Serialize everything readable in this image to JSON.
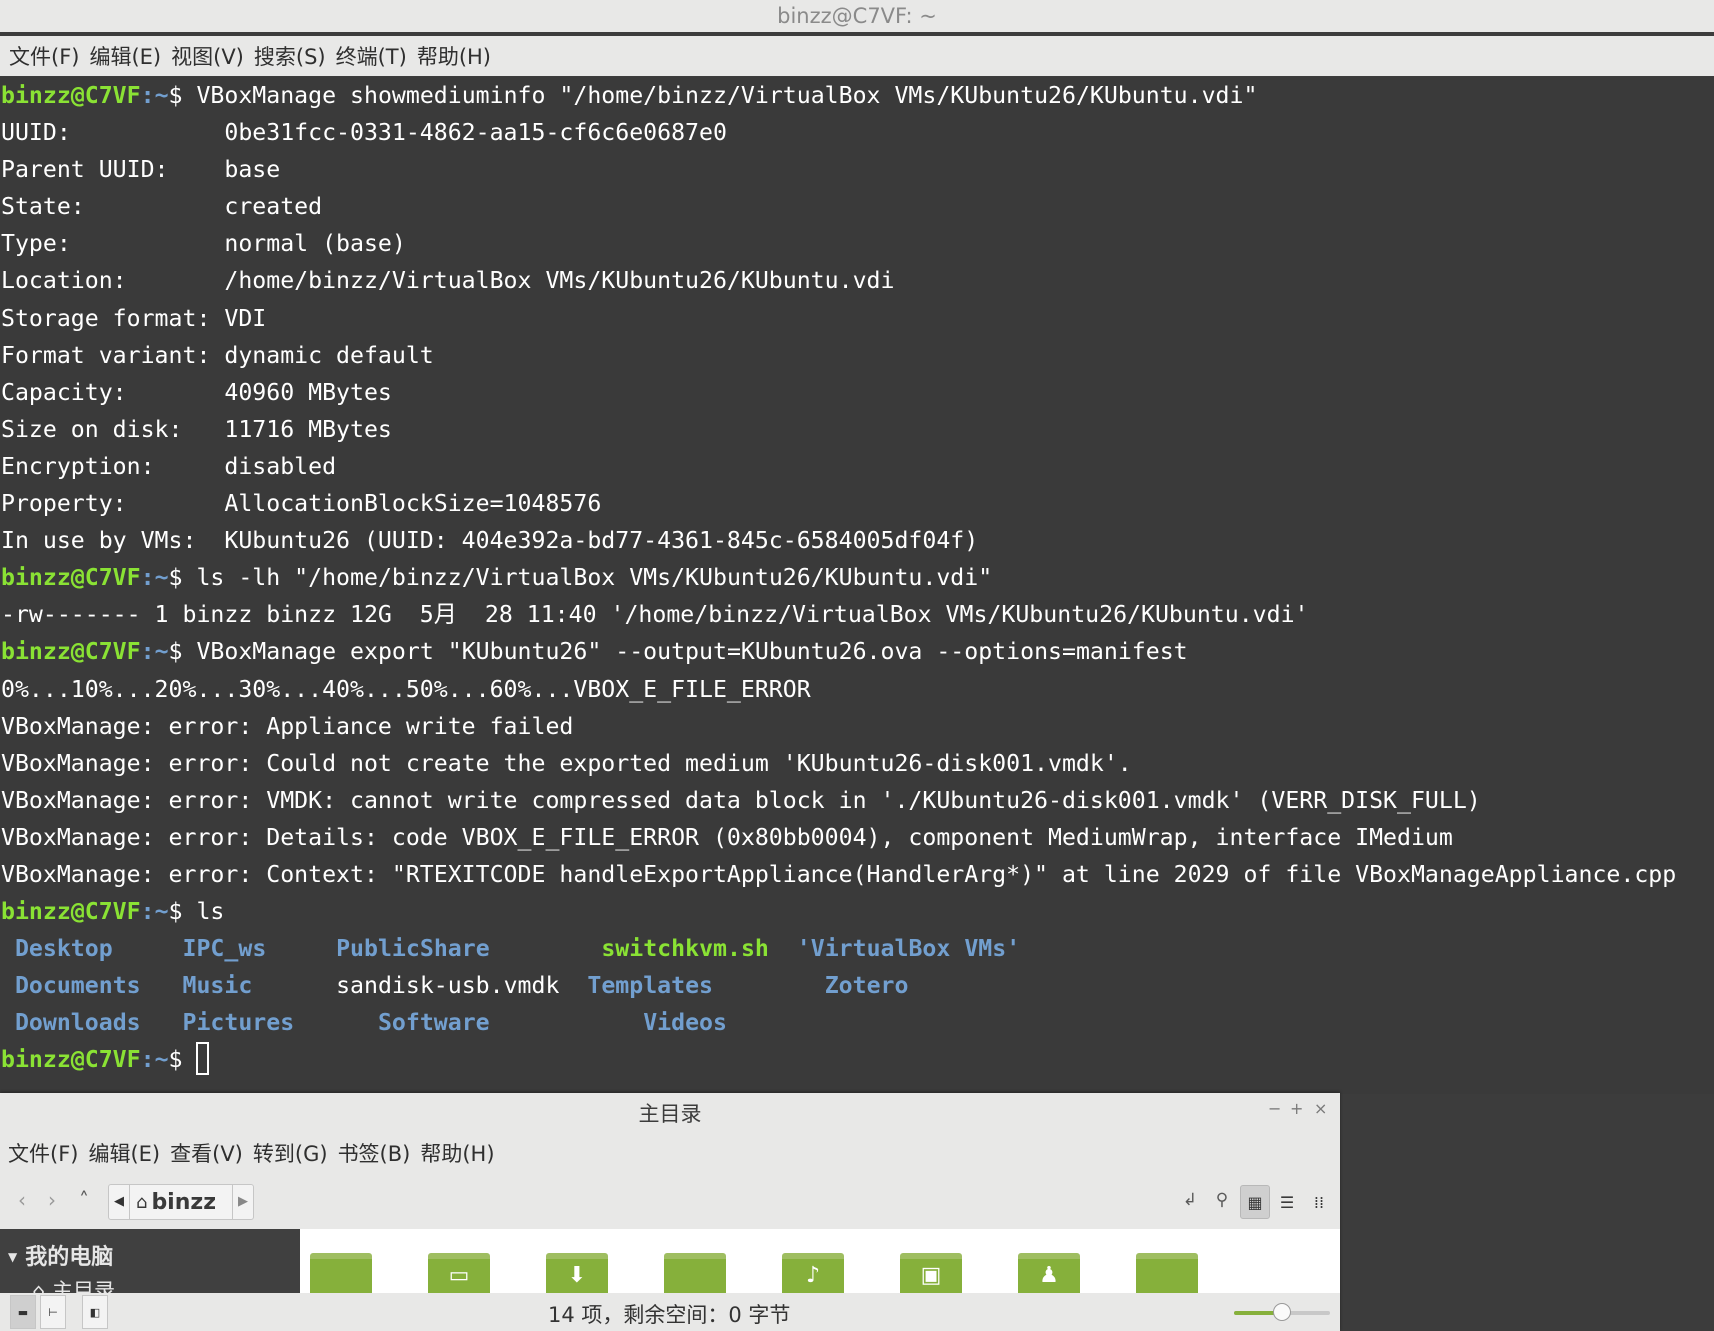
{
  "terminal": {
    "title": "binzz@C7VF: ~",
    "menu": [
      "文件(F)",
      "编辑(E)",
      "视图(V)",
      "搜索(S)",
      "终端(T)",
      "帮助(H)"
    ],
    "prompt_user": "binzz@C7VF",
    "prompt_path": ":~",
    "prompt_symbol": "$",
    "cmd1": " VBoxManage showmediuminfo \"/home/binzz/VirtualBox VMs/KUbuntu26/KUbuntu.vdi\"",
    "info": [
      "UUID:           0be31fcc-0331-4862-aa15-cf6c6e0687e0",
      "Parent UUID:    base",
      "State:          created",
      "Type:           normal (base)",
      "Location:       /home/binzz/VirtualBox VMs/KUbuntu26/KUbuntu.vdi",
      "Storage format: VDI",
      "Format variant: dynamic default",
      "Capacity:       40960 MBytes",
      "Size on disk:   11716 MBytes",
      "Encryption:     disabled",
      "Property:       AllocationBlockSize=1048576",
      "In use by VMs:  KUbuntu26 (UUID: 404e392a-bd77-4361-845c-6584005df04f)"
    ],
    "cmd2": " ls -lh \"/home/binzz/VirtualBox VMs/KUbuntu26/KUbuntu.vdi\"",
    "ls_out": "-rw------- 1 binzz binzz 12G  5月  28 11:40 '/home/binzz/VirtualBox VMs/KUbuntu26/KUbuntu.vdi'",
    "cmd3": " VBoxManage export \"KUbuntu26\" --output=KUbuntu26.ova --options=manifest",
    "export_out": [
      "0%...10%...20%...30%...40%...50%...60%...VBOX_E_FILE_ERROR",
      "VBoxManage: error: Appliance write failed",
      "VBoxManage: error: Could not create the exported medium 'KUbuntu26-disk001.vmdk'.",
      "VBoxManage: error: VMDK: cannot write compressed data block in './KUbuntu26-disk001.vmdk' (VERR_DISK_FULL)",
      "VBoxManage: error: Details: code VBOX_E_FILE_ERROR (0x80bb0004), component MediumWrap, interface IMedium",
      "VBoxManage: error: Context: \"RTEXITCODE handleExportAppliance(HandlerArg*)\" at line 2029 of file VBoxManageAppliance.cpp"
    ],
    "cmd4": " ls",
    "ls_rows": [
      [
        {
          "text": "Desktop",
          "kind": "dir",
          "pad": " "
        },
        {
          "text": "IPC_ws",
          "kind": "dir",
          "pad": "     "
        },
        {
          "text": "PublicShare",
          "kind": "dir",
          "pad": "     "
        },
        {
          "text": "switchkvm.sh",
          "kind": "exe",
          "pad": "        "
        },
        {
          "text": "'VirtualBox VMs'",
          "kind": "dir",
          "pad": "  "
        }
      ],
      [
        {
          "text": "Documents",
          "kind": "dir",
          "pad": " "
        },
        {
          "text": "Music",
          "kind": "dir",
          "pad": "   "
        },
        {
          "text": "sandisk-usb.vmdk",
          "kind": "file",
          "pad": "      "
        },
        {
          "text": "Templates",
          "kind": "dir",
          "pad": "  "
        },
        {
          "text": "Zotero",
          "kind": "dir",
          "pad": "        "
        }
      ],
      [
        {
          "text": "Downloads",
          "kind": "dir",
          "pad": " "
        },
        {
          "text": "Pictures",
          "kind": "dir",
          "pad": "   "
        },
        {
          "text": "Software",
          "kind": "dir",
          "pad": "      "
        },
        {
          "text": "Videos",
          "kind": "dir",
          "pad": "           "
        }
      ]
    ]
  },
  "file_manager": {
    "title": "主目录",
    "window_controls": [
      "−",
      "+",
      "×"
    ],
    "menu": [
      "文件(F)",
      "编辑(E)",
      "查看(V)",
      "转到(G)",
      "书签(B)",
      "帮助(H)"
    ],
    "breadcrumb": "binzz",
    "sidebar": {
      "section": "我的电脑",
      "items": [
        "主目录"
      ]
    },
    "folders": [
      {
        "icon": "folder-desktop-icon",
        "glyph": ""
      },
      {
        "icon": "folder-documents-icon",
        "glyph": "▭"
      },
      {
        "icon": "folder-downloads-icon",
        "glyph": "⬇"
      },
      {
        "icon": "folder-generic-icon",
        "glyph": ""
      },
      {
        "icon": "folder-music-icon",
        "glyph": "♪"
      },
      {
        "icon": "folder-pictures-icon",
        "glyph": "▣"
      },
      {
        "icon": "folder-public-icon",
        "glyph": "♟"
      },
      {
        "icon": "folder-generic-icon",
        "glyph": ""
      }
    ],
    "status_text": "14 项，剩余空间：0 字节",
    "zoom_level": 0.5
  },
  "colors": {
    "terminal_bg": "#3a3a3a",
    "prompt_user": "#8ae234",
    "prompt_path": "#729fcf",
    "folder_green": "#86b03b"
  }
}
